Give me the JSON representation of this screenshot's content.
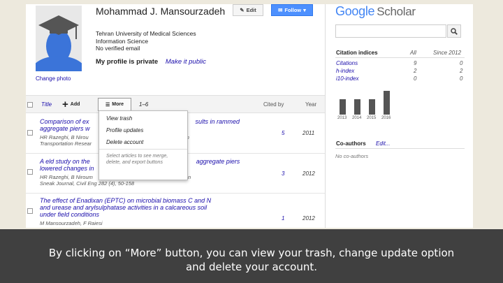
{
  "profile": {
    "name": "Mohammad J. Mansourzadeh",
    "lines": [
      "Tehran University of Medical Sciences",
      "Information Science",
      "No verified email"
    ],
    "private_text": "My profile is private",
    "make_public": "Make it public",
    "change_photo": "Change photo",
    "edit_label": "Edit",
    "follow_label": "Follow"
  },
  "table": {
    "title_col": "Title",
    "add_label": "Add",
    "more_label": "More",
    "range": "1–6",
    "cited_col": "Cited by",
    "year_col": "Year",
    "rows": [
      {
        "title_a": "Comparison of ex",
        "title_a2": "sults in rammed",
        "title_b": "aggregate piers w",
        "authors_a": "HR Razeghi, B Nirou",
        "authors_a2": "en",
        "authors_b": "Transportation Resear",
        "cited": "5",
        "year": "2011"
      },
      {
        "title_a": "A eld study on the",
        "title_a2": "aggregate piers",
        "title_b": "lowered changes in",
        "authors_a": "HR Razeghi, B Niroum",
        "authors_a2": "en",
        "authors_b": "Sneak Journal, Civil Eng 282 (4), 50-158",
        "cited": "3",
        "year": "2012"
      },
      {
        "title_a": "The effect of Enadixan (EPTC) on microbial biomass C and N",
        "title_a2": "",
        "title_b": "and urease and arylsulphatase activities in a calcareous soil",
        "title_c": "under field conditions",
        "authors_a": "M Mansourzadeh, F Raiesi",
        "authors_a2": "",
        "authors_b": "",
        "cited": "1",
        "year": "2012"
      }
    ]
  },
  "more_menu": {
    "items": [
      "View trash",
      "Profile updates",
      "Delete account"
    ],
    "note": "Select articles to see merge, delete, and export buttons"
  },
  "sidebar": {
    "logo_google": "Google",
    "logo_scholar": "Scholar",
    "citation_title": "Citation indices",
    "all_col": "All",
    "since_col": "Since 2012",
    "indices": [
      {
        "label": "Citations",
        "all": "9",
        "since": "0"
      },
      {
        "label": "h-index",
        "all": "2",
        "since": "2"
      },
      {
        "label": "i10-index",
        "all": "0",
        "since": "0"
      }
    ],
    "histogram": {
      "years": [
        "2013",
        "2014",
        "2015",
        "2016"
      ]
    },
    "coauthors_title": "Co-authors",
    "coauthors_edit": "Edit...",
    "no_coauthors": "No co-authors"
  },
  "caption": {
    "line1": "By clicking on “More” button, you can view your trash, change update option",
    "line2": "and delete your account."
  },
  "colors": {
    "link": "#1a0dab",
    "follow_button": "#4d90fe",
    "caption_bg": "#404040"
  }
}
